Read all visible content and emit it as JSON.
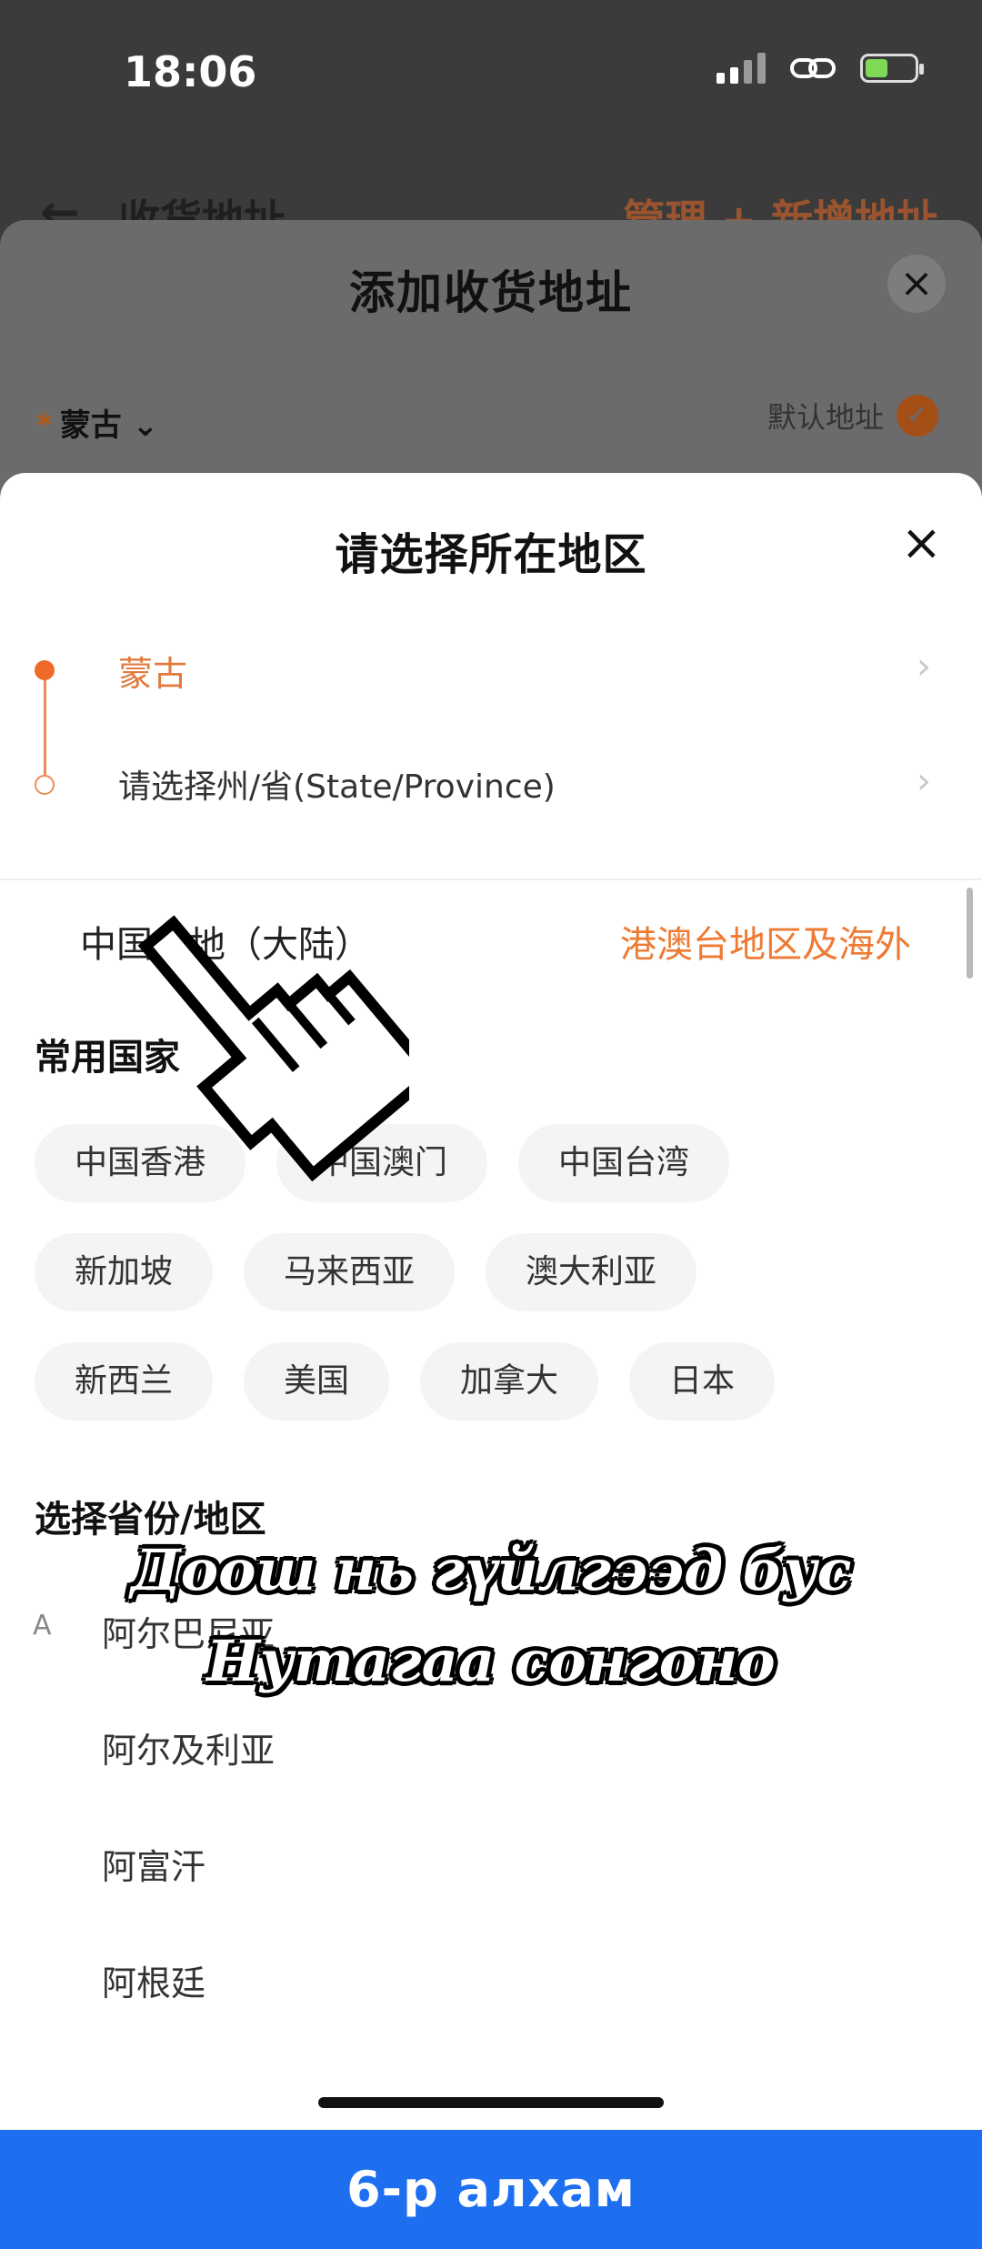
{
  "status_bar": {
    "time": "18:06"
  },
  "background_page": {
    "title": "收货地址",
    "back_icon": "←",
    "actions": "管理 + 新增地址"
  },
  "add_address_sheet": {
    "title": "添加收货地址",
    "country": "蒙古",
    "required_mark": "*",
    "default_label": "默认地址",
    "close_icon": "×"
  },
  "region_picker": {
    "title": "请选择所在地区",
    "close_icon": "×",
    "steps": [
      {
        "label": "蒙古"
      },
      {
        "label": "请选择州/省(State/Province)"
      }
    ],
    "tabs": [
      {
        "label": "中国内地（大陆）"
      },
      {
        "label": "港澳台地区及海外"
      }
    ],
    "common_section_title": "常用国家",
    "common_countries": [
      [
        "中国香港",
        "中国澳门",
        "中国台湾"
      ],
      [
        "新加坡",
        "马来西亚",
        "澳大利亚"
      ],
      [
        "新西兰",
        "美国",
        "加拿大",
        "日本"
      ]
    ],
    "province_section_title": "选择省份/地区",
    "province_list": [
      {
        "letter": "A",
        "name": "阿尔巴尼亚"
      },
      {
        "letter": "",
        "name": "阿尔及利亚"
      },
      {
        "letter": "",
        "name": "阿富汗"
      },
      {
        "letter": "",
        "name": "阿根廷"
      }
    ]
  },
  "caption": {
    "line1": "Доош нь гүйлгээд бус",
    "line2": "Нутагаа сонгоно"
  },
  "step_banner": "6-р алхам",
  "colors": {
    "accent": "#ee7a33",
    "banner": "#1e6ff0"
  }
}
